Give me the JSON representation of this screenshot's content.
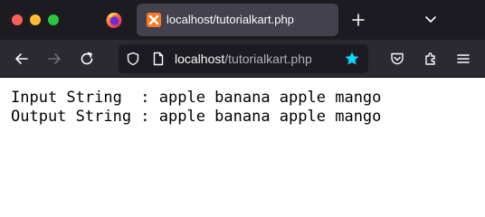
{
  "window": {
    "controls": [
      "close",
      "minimize",
      "maximize"
    ]
  },
  "tab": {
    "title": "localhost/tutorialkart.php",
    "favicon": "xampp-icon"
  },
  "toolbar": {
    "url_host": "localhost",
    "url_path": "/tutorialkart.php",
    "bookmarked": true,
    "accent_color": "#00ddff"
  },
  "page": {
    "lines": [
      "Input String  : apple banana apple mango",
      "Output String : apple banana apple mango"
    ]
  }
}
